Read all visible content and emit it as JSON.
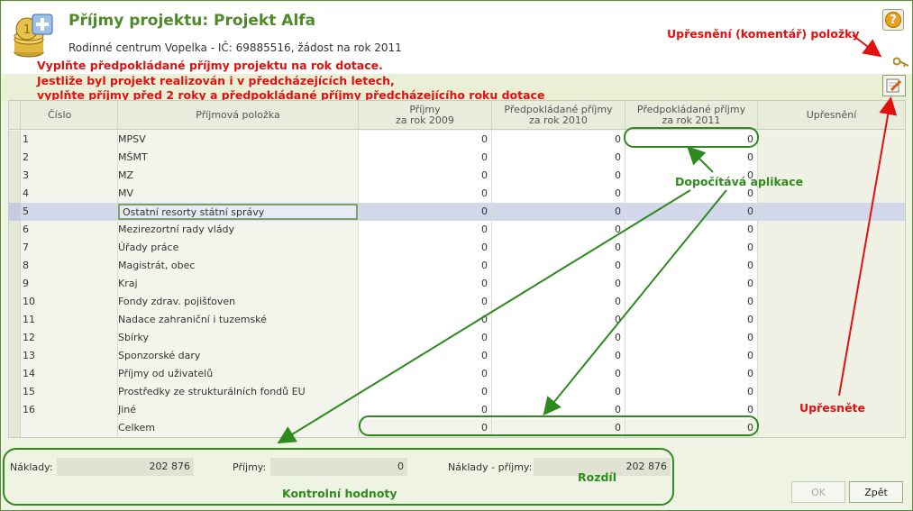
{
  "header": {
    "title": "Příjmy projektu: Projekt Alfa",
    "subtitle": "Rodinné centrum Vopelka - IČ: 69885516, žádost na rok 2011",
    "help_label": "?"
  },
  "instructions": [
    "Vyplňte předpokládané příjmy projektu na rok dotace.",
    "Jestliže byl projekt realizován i v předcházejících letech,",
    "vyplňte příjmy před 2 roky a předpokládané příjmy předcházejícího roku dotace"
  ],
  "annotations": {
    "comment_note": "Upřesnění (komentář) položky",
    "computed_note": "Dopočítává aplikace",
    "specify_note": "Upřesněte",
    "difference_note": "Rozdíl",
    "control_note": "Kontrolní hodnoty"
  },
  "table": {
    "columns": {
      "num": "Číslo",
      "name": "Příjmová položka",
      "v1": "Příjmy\nza rok 2009",
      "v2": "Předpokládané příjmy\nza rok 2010",
      "v3": "Předpokládané příjmy\nza rok 2011",
      "note": "Upřesnění"
    },
    "rows": [
      {
        "num": "1",
        "name": "MPSV",
        "v1": "0",
        "v2": "0",
        "v3": "0"
      },
      {
        "num": "2",
        "name": "MŠMT",
        "v1": "0",
        "v2": "0",
        "v3": "0"
      },
      {
        "num": "3",
        "name": "MZ",
        "v1": "0",
        "v2": "0",
        "v3": "0"
      },
      {
        "num": "4",
        "name": "MV",
        "v1": "0",
        "v2": "0",
        "v3": "0"
      },
      {
        "num": "5",
        "name": "Ostatní resorty státní správy",
        "v1": "0",
        "v2": "0",
        "v3": "0"
      },
      {
        "num": "6",
        "name": "Mezirezortní rady vlády",
        "v1": "0",
        "v2": "0",
        "v3": "0"
      },
      {
        "num": "7",
        "name": "Úřady práce",
        "v1": "0",
        "v2": "0",
        "v3": "0"
      },
      {
        "num": "8",
        "name": "Magistrát, obec",
        "v1": "0",
        "v2": "0",
        "v3": "0"
      },
      {
        "num": "9",
        "name": "Kraj",
        "v1": "0",
        "v2": "0",
        "v3": "0"
      },
      {
        "num": "10",
        "name": "Fondy zdrav. pojišťoven",
        "v1": "0",
        "v2": "0",
        "v3": "0"
      },
      {
        "num": "11",
        "name": "Nadace zahraniční i tuzemské",
        "v1": "0",
        "v2": "0",
        "v3": "0"
      },
      {
        "num": "12",
        "name": "Sbírky",
        "v1": "0",
        "v2": "0",
        "v3": "0"
      },
      {
        "num": "13",
        "name": "Sponzorské dary",
        "v1": "0",
        "v2": "0",
        "v3": "0"
      },
      {
        "num": "14",
        "name": "Příjmy od uživatelů",
        "v1": "0",
        "v2": "0",
        "v3": "0"
      },
      {
        "num": "15",
        "name": "Prostředky ze strukturálních fondů EU",
        "v1": "0",
        "v2": "0",
        "v3": "0"
      },
      {
        "num": "16",
        "name": "Jiné",
        "v1": "0",
        "v2": "0",
        "v3": "0"
      }
    ],
    "total": {
      "name": "Celkem",
      "v1": "0",
      "v2": "0",
      "v3": "0"
    },
    "selected_row": 5
  },
  "controls": {
    "costs_label": "Náklady:",
    "costs_value": "202 876",
    "income_label": "Příjmy:",
    "income_value": "0",
    "diff_label": "Náklady - příjmy:",
    "diff_value": "202 876"
  },
  "buttons": {
    "ok": "OK",
    "back": "Zpět"
  }
}
